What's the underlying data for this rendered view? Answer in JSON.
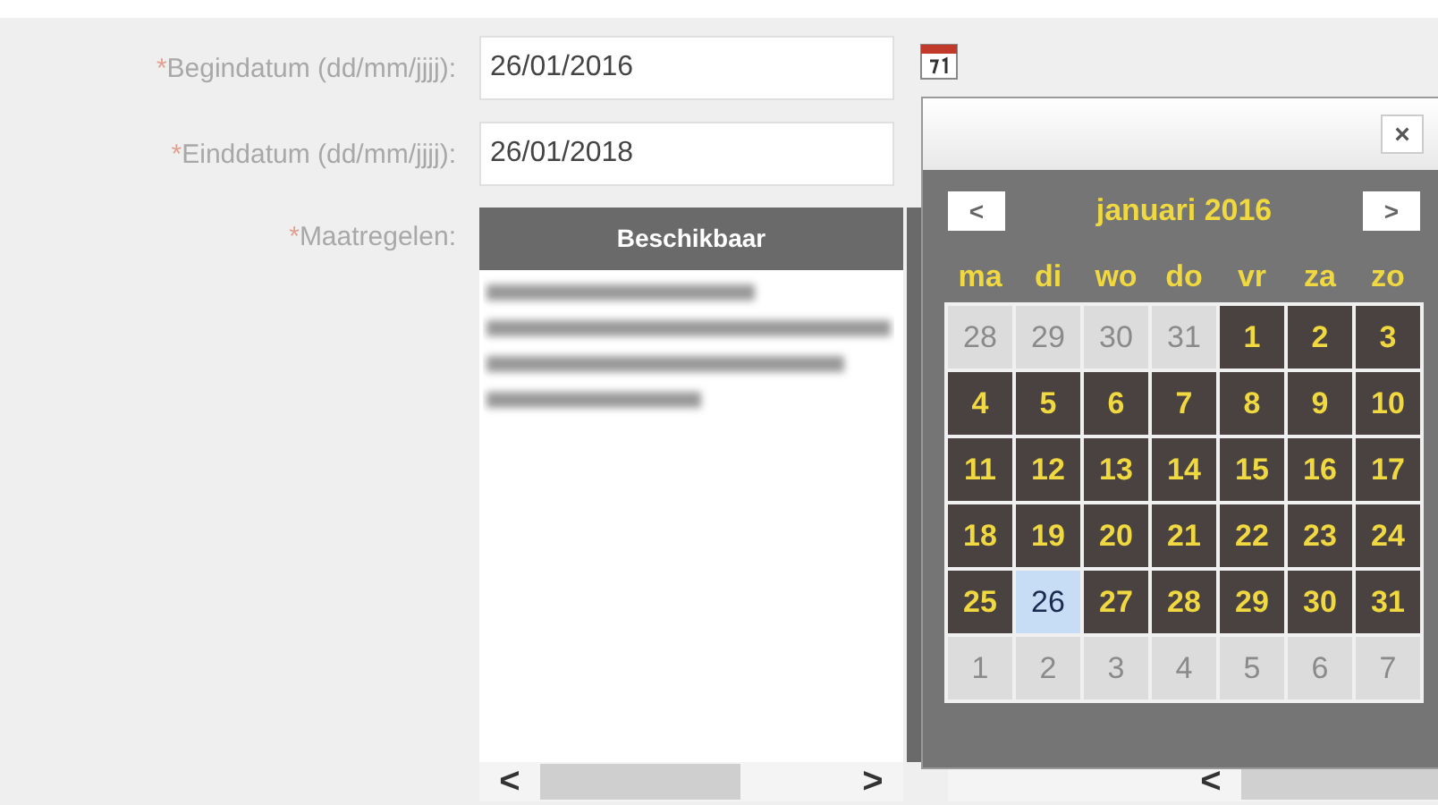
{
  "form": {
    "fields": [
      {
        "marker": "*",
        "label": "Begindatum (dd/mm/jjjj):",
        "value": "26/01/2016"
      },
      {
        "marker": "*",
        "label": "Einddatum (dd/mm/jjjj):",
        "value": "26/01/2018"
      }
    ],
    "measures": {
      "marker": "*",
      "label": "Maatregelen:"
    },
    "list_header": "Beschikbaar",
    "scroll_left": "<",
    "scroll_right": ">",
    "scroll2_left": "<"
  },
  "calendar": {
    "close": "×",
    "prev": "<",
    "next": ">",
    "month": "januari 2016",
    "weekdays": [
      "ma",
      "di",
      "wo",
      "do",
      "vr",
      "za",
      "zo"
    ],
    "days": [
      {
        "label": "28",
        "in_month": false,
        "selected": false
      },
      {
        "label": "29",
        "in_month": false,
        "selected": false
      },
      {
        "label": "30",
        "in_month": false,
        "selected": false
      },
      {
        "label": "31",
        "in_month": false,
        "selected": false
      },
      {
        "label": "1",
        "in_month": true,
        "selected": false
      },
      {
        "label": "2",
        "in_month": true,
        "selected": false
      },
      {
        "label": "3",
        "in_month": true,
        "selected": false
      },
      {
        "label": "4",
        "in_month": true,
        "selected": false
      },
      {
        "label": "5",
        "in_month": true,
        "selected": false
      },
      {
        "label": "6",
        "in_month": true,
        "selected": false
      },
      {
        "label": "7",
        "in_month": true,
        "selected": false
      },
      {
        "label": "8",
        "in_month": true,
        "selected": false
      },
      {
        "label": "9",
        "in_month": true,
        "selected": false
      },
      {
        "label": "10",
        "in_month": true,
        "selected": false
      },
      {
        "label": "11",
        "in_month": true,
        "selected": false
      },
      {
        "label": "12",
        "in_month": true,
        "selected": false
      },
      {
        "label": "13",
        "in_month": true,
        "selected": false
      },
      {
        "label": "14",
        "in_month": true,
        "selected": false
      },
      {
        "label": "15",
        "in_month": true,
        "selected": false
      },
      {
        "label": "16",
        "in_month": true,
        "selected": false
      },
      {
        "label": "17",
        "in_month": true,
        "selected": false
      },
      {
        "label": "18",
        "in_month": true,
        "selected": false
      },
      {
        "label": "19",
        "in_month": true,
        "selected": false
      },
      {
        "label": "20",
        "in_month": true,
        "selected": false
      },
      {
        "label": "21",
        "in_month": true,
        "selected": false
      },
      {
        "label": "22",
        "in_month": true,
        "selected": false
      },
      {
        "label": "23",
        "in_month": true,
        "selected": false
      },
      {
        "label": "24",
        "in_month": true,
        "selected": false
      },
      {
        "label": "25",
        "in_month": true,
        "selected": false
      },
      {
        "label": "26",
        "in_month": true,
        "selected": true
      },
      {
        "label": "27",
        "in_month": true,
        "selected": false
      },
      {
        "label": "28",
        "in_month": true,
        "selected": false
      },
      {
        "label": "29",
        "in_month": true,
        "selected": false
      },
      {
        "label": "30",
        "in_month": true,
        "selected": false
      },
      {
        "label": "31",
        "in_month": true,
        "selected": false
      },
      {
        "label": "1",
        "in_month": false,
        "selected": false
      },
      {
        "label": "2",
        "in_month": false,
        "selected": false
      },
      {
        "label": "3",
        "in_month": false,
        "selected": false
      },
      {
        "label": "4",
        "in_month": false,
        "selected": false
      },
      {
        "label": "5",
        "in_month": false,
        "selected": false
      },
      {
        "label": "6",
        "in_month": false,
        "selected": false
      },
      {
        "label": "7",
        "in_month": false,
        "selected": false
      }
    ]
  }
}
